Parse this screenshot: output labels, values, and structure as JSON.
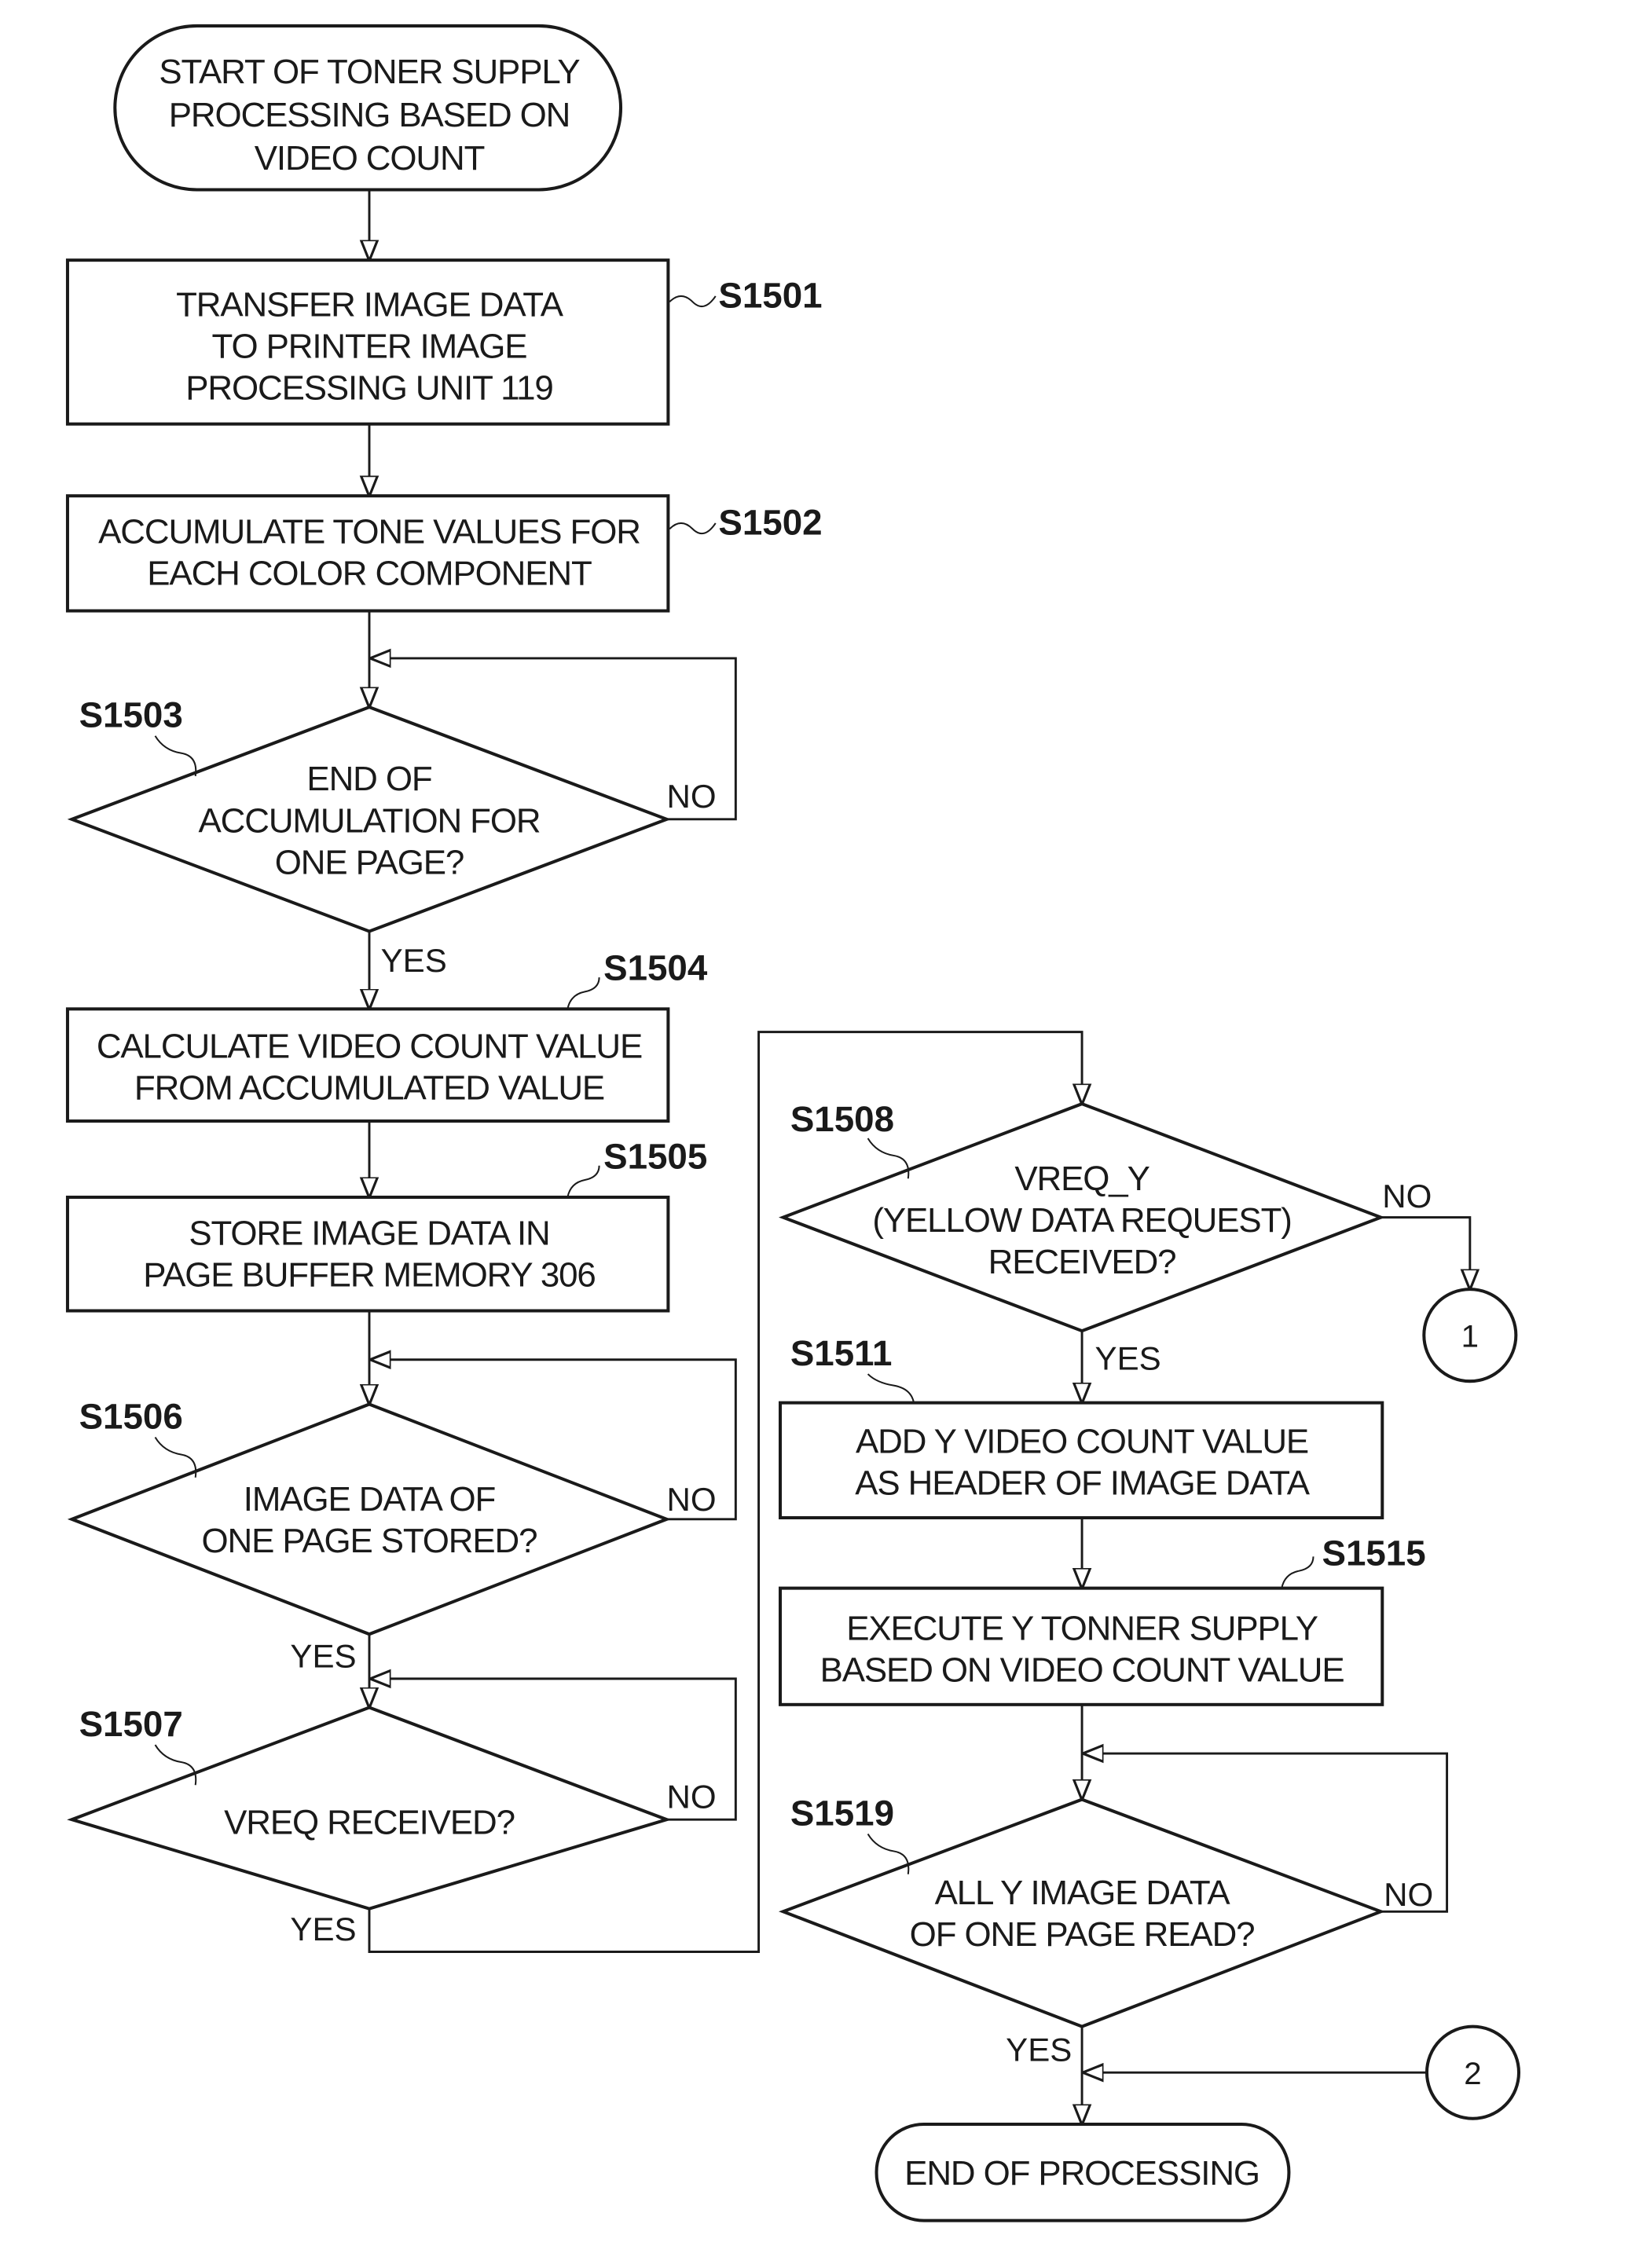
{
  "figure": {
    "type": "flowchart",
    "start": {
      "lines": [
        "START OF TONER SUPPLY",
        "PROCESSING BASED ON",
        "VIDEO COUNT"
      ]
    },
    "end": {
      "lines": [
        "END OF PROCESSING"
      ]
    },
    "steps": {
      "s1501": {
        "id": "S1501",
        "lines": [
          "TRANSFER IMAGE DATA",
          "TO PRINTER IMAGE",
          "PROCESSING UNIT 119"
        ]
      },
      "s1502": {
        "id": "S1502",
        "lines": [
          "ACCUMULATE TONE VALUES FOR",
          "EACH COLOR COMPONENT"
        ]
      },
      "s1503": {
        "id": "S1503",
        "lines": [
          "END OF",
          "ACCUMULATION FOR",
          "ONE PAGE?"
        ]
      },
      "s1504": {
        "id": "S1504",
        "lines": [
          "CALCULATE VIDEO COUNT VALUE",
          "FROM ACCUMULATED VALUE"
        ]
      },
      "s1505": {
        "id": "S1505",
        "lines": [
          "STORE IMAGE DATA IN",
          "PAGE BUFFER MEMORY 306"
        ]
      },
      "s1506": {
        "id": "S1506",
        "lines": [
          "IMAGE DATA OF",
          "ONE PAGE STORED?"
        ]
      },
      "s1507": {
        "id": "S1507",
        "lines": [
          "VREQ RECEIVED?"
        ]
      },
      "s1508": {
        "id": "S1508",
        "lines": [
          "VREQ_Y",
          "(YELLOW DATA REQUEST)",
          "RECEIVED?"
        ]
      },
      "s1511": {
        "id": "S1511",
        "lines": [
          "ADD Y VIDEO COUNT VALUE",
          "AS HEADER OF IMAGE DATA"
        ]
      },
      "s1515": {
        "id": "S1515",
        "lines": [
          "EXECUTE Y TONNER SUPPLY",
          "BASED ON VIDEO COUNT VALUE"
        ]
      },
      "s1519": {
        "id": "S1519",
        "lines": [
          "ALL Y IMAGE DATA",
          "OF ONE PAGE READ?"
        ]
      }
    },
    "branch_labels": {
      "yes": "YES",
      "no": "NO"
    },
    "connectors": {
      "c1": "1",
      "c2": "2"
    }
  }
}
